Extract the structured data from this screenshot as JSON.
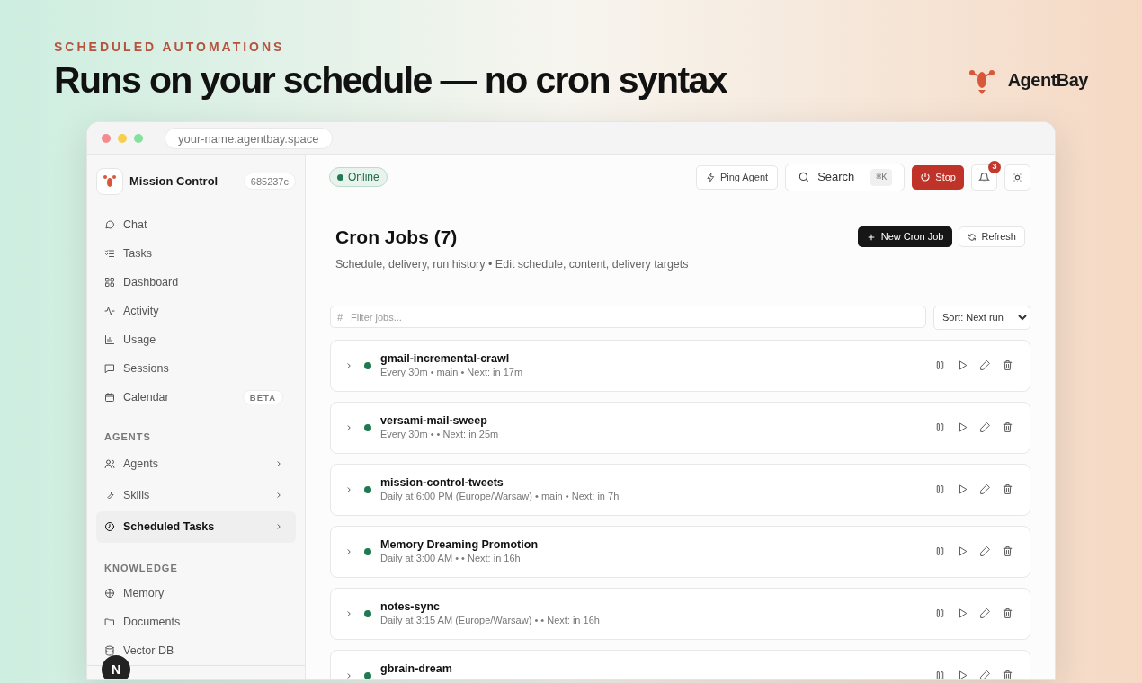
{
  "hero": {
    "eyebrow": "SCHEDULED AUTOMATIONS",
    "headline": "Runs on your schedule — no cron syntax",
    "brand": "AgentBay"
  },
  "browser": {
    "url": "your-name.agentbay.space"
  },
  "sidebar": {
    "title": "Mission Control",
    "build": "685237c",
    "sections": [
      {
        "items": [
          {
            "label": "Chat",
            "selected": false,
            "kind": "link"
          },
          {
            "label": "Tasks",
            "selected": false,
            "kind": "link"
          },
          {
            "label": "Dashboard",
            "selected": false,
            "kind": "link"
          },
          {
            "label": "Activity",
            "selected": false,
            "kind": "link"
          },
          {
            "label": "Usage",
            "selected": false,
            "kind": "link"
          },
          {
            "label": "Sessions",
            "selected": false,
            "kind": "link"
          },
          {
            "label": "Calendar",
            "selected": false,
            "kind": "link",
            "badge": "BETA"
          }
        ]
      },
      {
        "heading": "AGENTS",
        "items": [
          {
            "label": "Agents",
            "selected": false,
            "kind": "group"
          },
          {
            "label": "Skills",
            "selected": false,
            "kind": "group"
          },
          {
            "label": "Scheduled Tasks",
            "selected": true,
            "kind": "group"
          }
        ]
      },
      {
        "heading": "KNOWLEDGE",
        "items": [
          {
            "label": "Memory",
            "selected": false,
            "kind": "link"
          },
          {
            "label": "Documents",
            "selected": false,
            "kind": "link"
          },
          {
            "label": "Vector DB",
            "selected": false,
            "kind": "link"
          }
        ]
      }
    ],
    "avatar": "N"
  },
  "topbar": {
    "status": "Online",
    "online": true,
    "ping": "Ping Agent",
    "search": "Search",
    "shortcut": "⌘K",
    "stop": "Stop",
    "notifications": "3"
  },
  "page": {
    "title": "Cron Jobs (7)",
    "subtitle": "Schedule, delivery, run history • Edit schedule, content, delivery targets",
    "new_button": "New Cron Job",
    "refresh_button": "Refresh"
  },
  "filter": {
    "placeholder": "Filter jobs...",
    "prefix": "#"
  },
  "sort": "Sort: Next run",
  "jobs": [
    {
      "name": "gmail-incremental-crawl",
      "meta": "Every 30m • main • Next: in 17m",
      "active": true
    },
    {
      "name": "versami-mail-sweep",
      "meta": "Every 30m • • Next: in 25m",
      "active": true
    },
    {
      "name": "mission-control-tweets",
      "meta": "Daily at 6:00 PM (Europe/Warsaw) • main • Next: in 7h",
      "active": true
    },
    {
      "name": "Memory Dreaming Promotion",
      "meta": "Daily at 3:00 AM • • Next: in 16h",
      "active": true
    },
    {
      "name": "notes-sync",
      "meta": "Daily at 3:15 AM (Europe/Warsaw) • • Next: in 16h",
      "active": true
    },
    {
      "name": "gbrain-dream",
      "active": true
    }
  ]
}
